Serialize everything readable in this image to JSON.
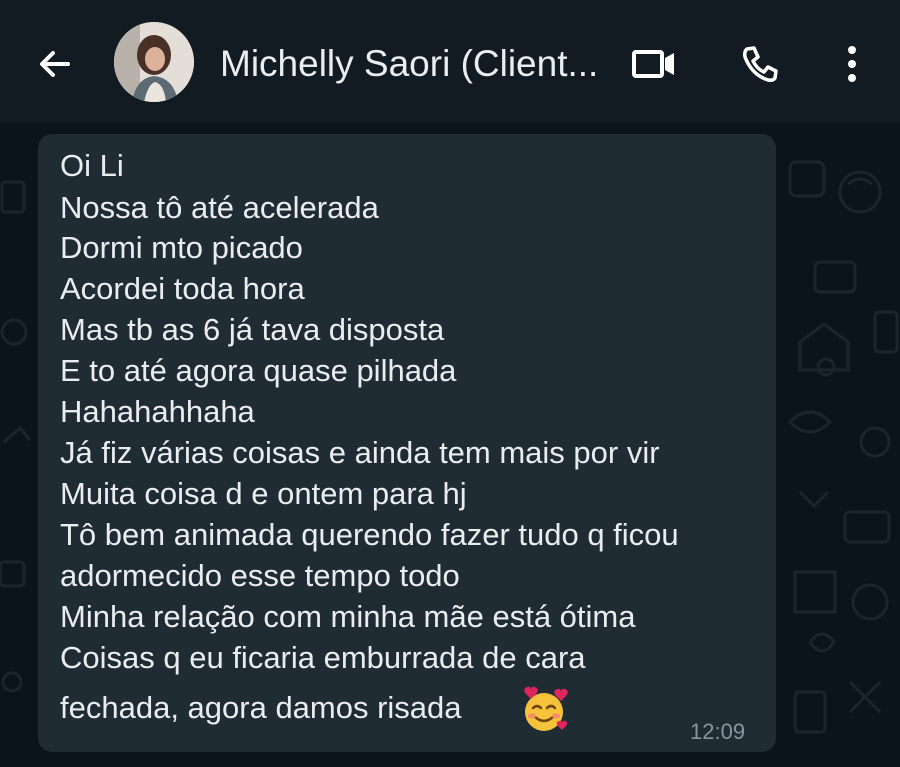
{
  "header": {
    "back_icon": "arrow-left-icon",
    "contact_name": "Michelly Saori (Client...",
    "video_icon": "video-camera-icon",
    "call_icon": "phone-icon",
    "menu_icon": "more-vertical-icon"
  },
  "message": {
    "lines": [
      "Oi Li",
      "Nossa tô até acelerada",
      "Dormi mto picado",
      "Acordei toda hora",
      "Mas tb as 6 já tava disposta",
      "E to até agora quase pilhada",
      "Hahahahhaha",
      "Já fiz várias coisas e ainda tem mais por vir",
      "Muita coisa d e ontem para hj",
      "Tô bem animada querendo fazer tudo q ficou",
      "adormecido esse tempo todo",
      "Minha relação com minha mãe está ótima",
      "Coisas q eu ficaria emburrada de cara",
      "fechada, agora damos risada"
    ],
    "emoji_icon": "smiling-face-with-hearts-icon",
    "time": "12:09"
  },
  "colors": {
    "header_bg": "#111b21",
    "chat_bg": "#0b141a",
    "bubble_bg": "#202c33",
    "text": "#e9edef",
    "muted": "#8696a0"
  }
}
